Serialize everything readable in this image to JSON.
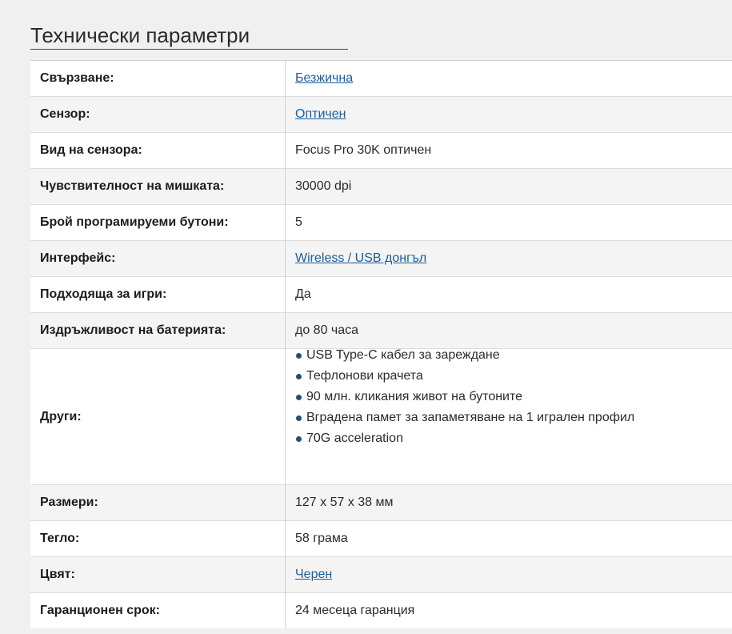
{
  "section": {
    "title": "Технически параметри"
  },
  "rows": [
    {
      "label": "Свързване:",
      "value": "Безжична",
      "link": true
    },
    {
      "label": "Сензор:",
      "value": "Оптичен",
      "link": true
    },
    {
      "label": "Вид на сензора:",
      "value": "Focus Pro 30K оптичен",
      "link": false
    },
    {
      "label": "Чувствителност на мишката:",
      "value": "30000 dpi",
      "link": false
    },
    {
      "label": "Брой програмируеми бутони:",
      "value": "5",
      "link": false
    },
    {
      "label": "Интерфейс:",
      "value": "Wireless / USB донгъл",
      "link": true
    },
    {
      "label": "Подходяща за игри:",
      "value": "Да",
      "link": false
    },
    {
      "label": "Издръжливост на батерията:",
      "value": "до 80 часа",
      "link": false
    },
    {
      "label": "Други:",
      "bullets": [
        "USB Type-C кабел за зареждане",
        "Тефлонови крачета",
        "90 млн. кликания живот на бутоните",
        "Вградена памет за запаметяване на 1 игрален профил",
        "70G acceleration"
      ]
    },
    {
      "label": "Размери:",
      "value": "127 x 57 x 38 мм",
      "link": false
    },
    {
      "label": "Тегло:",
      "value": "58 грама",
      "link": false
    },
    {
      "label": "Цвят:",
      "value": "Черен",
      "link": true
    },
    {
      "label": "Гаранционен срок:",
      "value": "24 месеца гаранция",
      "link": false
    }
  ]
}
